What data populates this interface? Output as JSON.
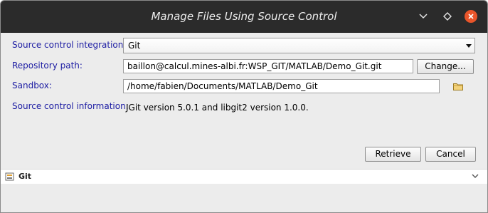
{
  "window": {
    "title": "Manage Files Using Source Control"
  },
  "titlebar_icons": {
    "minimize": "chevron-down-icon",
    "maximize": "diamond-icon",
    "close": "close-icon"
  },
  "form": {
    "integration_label": "Source control integration:",
    "integration_value": "Git",
    "repo_label": "Repository path:",
    "repo_value": "baillon@calcul.mines-albi.fr:WSP_GIT/MATLAB/Demo_Git.git",
    "change_button": "Change...",
    "sandbox_label": "Sandbox:",
    "sandbox_value": "/home/fabien/Documents/MATLAB/Demo_Git",
    "info_label": "Source control information:",
    "info_value": "JGit version 5.0.1 and libgit2 version 1.0.0."
  },
  "buttons": {
    "retrieve": "Retrieve",
    "cancel": "Cancel"
  },
  "details_bar": {
    "label": "Git"
  },
  "colors": {
    "label_blue": "#1c1ca3",
    "titlebar": "#2b2b2b",
    "close_orange": "#e9552a"
  }
}
